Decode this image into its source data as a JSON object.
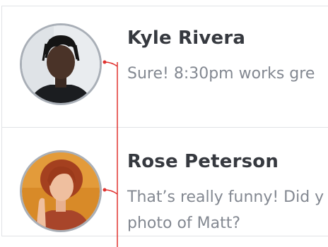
{
  "conversations": [
    {
      "name": "Kyle Rivera",
      "preview": "Sure! 8:30pm works gre",
      "avatar": "avatar-photo"
    },
    {
      "name": "Rose Peterson",
      "preview": "That’s really funny! Did y photo of Matt?",
      "avatar": "avatar-photo"
    }
  ],
  "colors": {
    "name_text": "#36393f",
    "preview_text": "#838891",
    "avatar_border": "#a9afb7",
    "divider": "#e1e3e6",
    "annotation_line": "#e0322f"
  }
}
